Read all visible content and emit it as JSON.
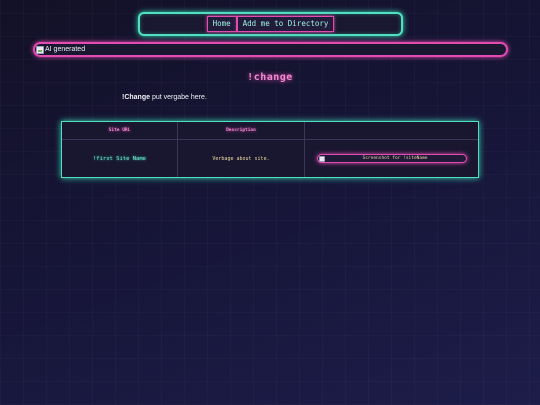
{
  "nav": {
    "home_label": "Home",
    "add_label": "Add me to Directory"
  },
  "hero": {
    "alt": "AI generated"
  },
  "page": {
    "title": "!change",
    "intro_bold": "!Change",
    "intro_rest": " put vergabe here."
  },
  "table": {
    "headers": [
      "Site URL",
      "Description",
      ""
    ],
    "rows": [
      {
        "site_name": "!first Site Name",
        "description": "Verbage about site.",
        "screenshot_alt": "Screenshot for !siteName"
      }
    ]
  },
  "colors": {
    "accent_teal": "#4fe0c0",
    "accent_pink": "#e24bb0",
    "background": "#17163a"
  }
}
